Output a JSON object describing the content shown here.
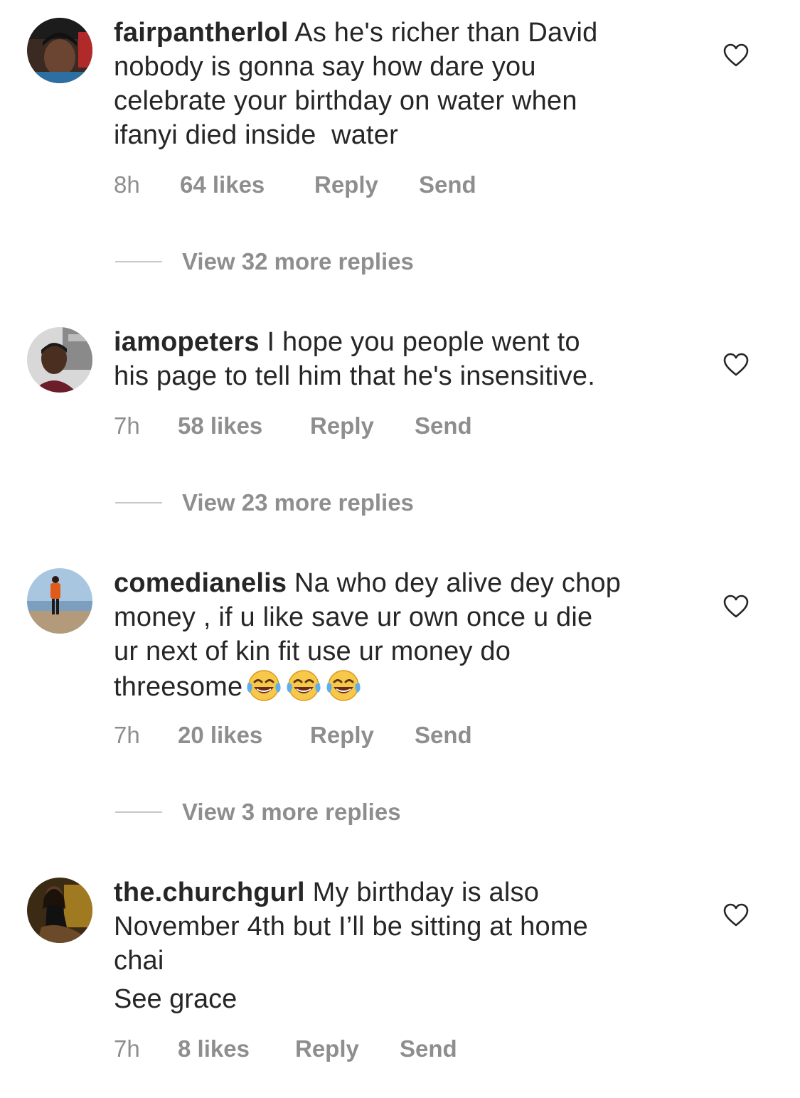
{
  "comments": [
    {
      "username": "fairpantherlol",
      "text": " As he's richer than David\nnobody is gonna say how dare you\ncelebrate your birthday on water when\nifanyi died inside  water",
      "time": "8h",
      "likes": "64 likes",
      "reply": "Reply",
      "send": "Send",
      "view_replies": "View 32 more replies"
    },
    {
      "username": "iamopeters",
      "text": " I hope you people went to\nhis page to tell him that he's insensitive.",
      "time": "7h",
      "likes": "58 likes",
      "reply": "Reply",
      "send": "Send",
      "view_replies": "View 23 more replies"
    },
    {
      "username": "comedianelis",
      "text": " Na who dey alive dey chop\nmoney , if u like save ur own once u die\nur next of kin fit use ur money do\nthreesome",
      "emoji": "face-with-tears-of-joy-icon",
      "emoji_count": 3,
      "time": "7h",
      "likes": "20 likes",
      "reply": "Reply",
      "send": "Send",
      "view_replies": "View 3 more replies"
    },
    {
      "username": "the.churchgurl",
      "text": " My birthday is also\nNovember 4th but I’ll be sitting at home\nchai",
      "extra": "See grace",
      "time": "7h",
      "likes": "8 likes",
      "reply": "Reply",
      "send": "Send"
    }
  ],
  "colors": {
    "text": "#262626",
    "secondary": "#8e8e8e",
    "divider": "#c7c7c7"
  },
  "icons": {
    "like": "heart-outline-icon"
  }
}
